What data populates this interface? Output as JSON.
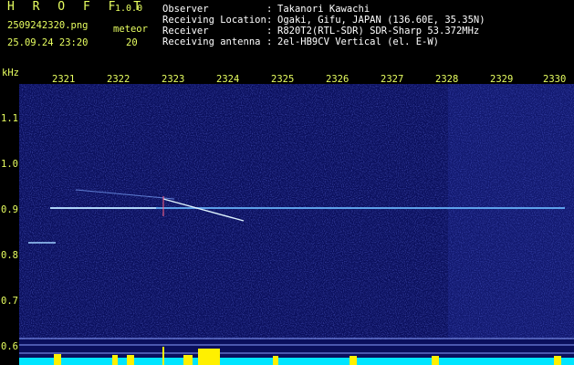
{
  "header": {
    "title": "H R O F F T",
    "version": "1.0.0",
    "filename": "2509242320.png",
    "datetime": "25.09.24 23:20",
    "count_label": "meteor",
    "count_value": "20"
  },
  "info": [
    {
      "label": "Observer",
      "value": "Takanori Kawachi"
    },
    {
      "label": "Receiving Location",
      "value": "Ogaki, Gifu, JAPAN (136.60E, 35.35N)"
    },
    {
      "label": "Receiver",
      "value": "R820T2(RTL-SDR) SDR-Sharp 53.372MHz"
    },
    {
      "label": "Receiving antenna",
      "value": "2el-HB9CV Vertical (el. E-W)"
    }
  ],
  "axes": {
    "y_unit": "kHz",
    "y_ticks": [
      "1.1",
      "1.0",
      "0.9",
      "0.8",
      "0.7",
      "0.6"
    ],
    "x_ticks": [
      "2321",
      "2322",
      "2323",
      "2324",
      "2325",
      "2326",
      "2327",
      "2328",
      "2329",
      "2330"
    ]
  },
  "colors": {
    "label_yellow": "#e8ff60",
    "text_white": "#ffffff",
    "spectrogram_bg": "#0a0f5c",
    "signal": "#bfe8ff",
    "level_bars": "#00e5ff",
    "peak_bars": "#fff000"
  }
}
